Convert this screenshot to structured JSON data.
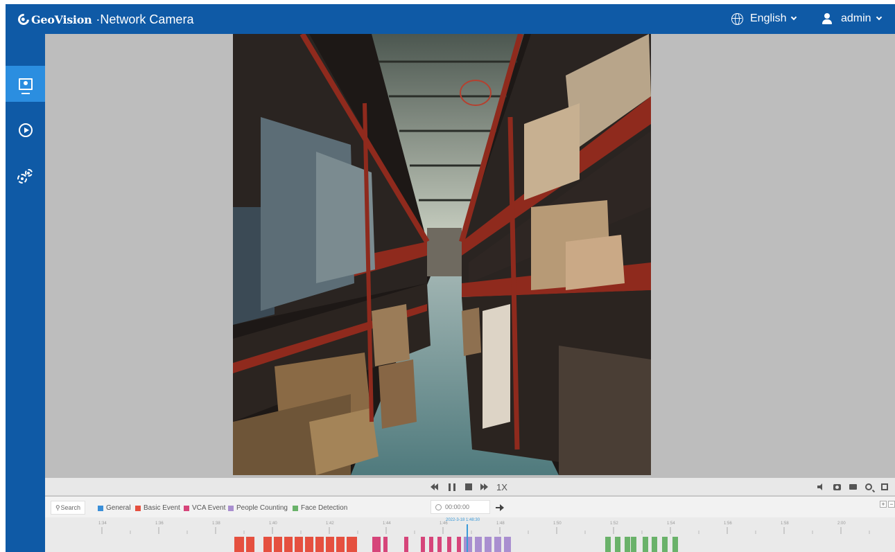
{
  "header": {
    "brand": "GeoVision",
    "product": "·Network Camera",
    "language": "English",
    "user": "admin"
  },
  "sidebar": {
    "items": [
      {
        "name": "live-view",
        "icon": "monitor-icon",
        "active": true
      },
      {
        "name": "playback",
        "icon": "play-circle-icon",
        "active": false
      },
      {
        "name": "settings",
        "icon": "gears-icon",
        "active": false
      }
    ]
  },
  "playback": {
    "speed": "1X"
  },
  "timeline": {
    "search_label": "Search",
    "time_value": "00:00:00",
    "cursor_timestamp": "2022-3-18 1:48:30",
    "legend": [
      {
        "label": "General",
        "color": "#3a8fd8"
      },
      {
        "label": "Basic Event",
        "color": "#e5503f"
      },
      {
        "label": "VCA Event",
        "color": "#d6457a"
      },
      {
        "label": "People Counting",
        "color": "#a98fd0"
      },
      {
        "label": "Face Detection",
        "color": "#6ab26a"
      }
    ],
    "ticks": [
      "1:34",
      "1:36",
      "1:38",
      "1:40",
      "1:42",
      "1:44",
      "1:46",
      "1:48",
      "1:50",
      "1:52",
      "1:54",
      "1:56",
      "1:58",
      "2:00"
    ]
  },
  "colors": {
    "header_bg": "#0f5aa6",
    "sidebar_active": "#2b8ee0",
    "shelf_red": "#8f2a1d"
  }
}
